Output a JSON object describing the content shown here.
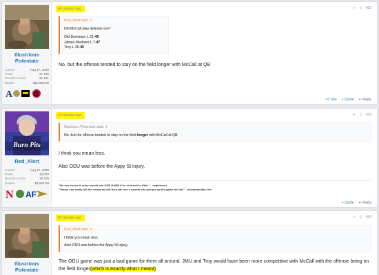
{
  "posts": [
    {
      "user": {
        "name": "Illustrious Potentate",
        "joined": "Aug 17, 2020",
        "posts": "27,788",
        "reaction_score": "31,191",
        "bookie": "$10,650.00"
      },
      "stat_labels": {
        "joined": "Joined",
        "posts": "Posts",
        "reaction": "Reaction score",
        "bookie": "Bookie"
      },
      "time": "46 minutes ago",
      "number": "#52",
      "quote": {
        "author": "Red_Alert said:",
        "lines": [
          "Did McCall play defense too?",
          "Old Dominion L 21-",
          "49",
          "James Madison L 7-",
          "47",
          "Troy L 26-",
          "45"
        ]
      },
      "message": "No, but the offense tended to stay on the field longer with McCall at QB",
      "actions": {
        "like": "Like",
        "quote": "Quote",
        "reply": "Reply"
      }
    },
    {
      "user": {
        "name": "Red_Alert",
        "joined": "Aug 17, 2020",
        "posts": "13,070",
        "reaction_score": "18,725",
        "bookie": "$1,501.00",
        "avatar_caption": "Burn Pits"
      },
      "stat_labels": {
        "joined": "Joined",
        "posts": "Posts",
        "reaction": "Reaction score",
        "bookie": "Bookie"
      },
      "time": "42 minutes ago",
      "number": "#53",
      "quote": {
        "author": "Illustrious Potentate said:",
        "pre": "No, but the offense tended to stay on the field ",
        "bold": "longer",
        "post": " with McCall at QB"
      },
      "message1": "I think you mean less.",
      "message2": "Also ODU was before the Appy St injury.",
      "sig1": "\"No one knows if urban would win ONE GAME if he returned to Utah.\" - calphiewru",
      "sig2": "\"Teams can easily tell the networks that they will use a neutral site and put up the game for bid.\" - michaeljordan_fan",
      "actions": {
        "quote": "Quote",
        "reply": "Reply"
      }
    },
    {
      "user": {
        "name": "Illustrious Potentate"
      },
      "time": "40 minutes ago",
      "number": "#54",
      "quote": {
        "author": "Red_Alert said:",
        "line1": "I think you mean less.",
        "line2": "Also ODU was before the Appy St injury."
      },
      "message_a": "The ODU game was just a bad game for them all around. JMU and Troy would have been more competitive with McCall with the offense being on the field longer",
      "message_b": "(which is exactly what I meant)"
    }
  ],
  "icons": {
    "share": "share-icon",
    "bookmark": "bookmark-icon",
    "like": "thumbs-up-icon",
    "quote": "plus-icon",
    "reply": "reply-arrow-icon"
  },
  "colors": {
    "accent": "#2577b1",
    "quote_border": "#f87c22",
    "highlight": "#fff300"
  }
}
